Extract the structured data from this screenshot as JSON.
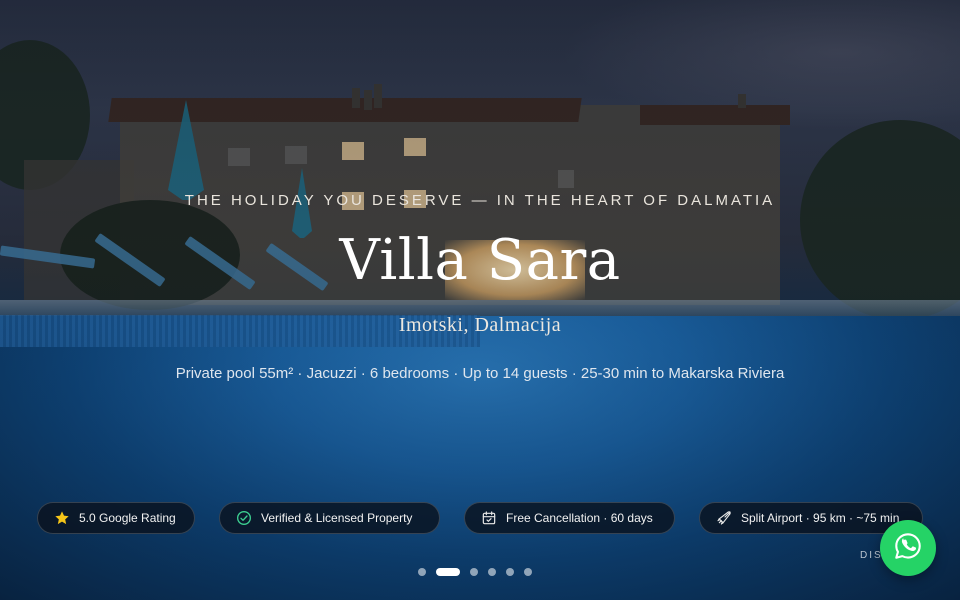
{
  "hero": {
    "eyebrow": "THE HOLIDAY YOU DESERVE — IN THE HEART OF DALMATIA",
    "title": "Villa Sara",
    "location": "Imotski, Dalmacija",
    "description": "Private pool 55m² · Jacuzzi · 6 bedrooms · Up to 14 guests · 25-30 min to Makarska Riviera"
  },
  "badges": [
    {
      "icon": "star-icon",
      "label": "5.0 Google Rating"
    },
    {
      "icon": "check-circle-icon",
      "label": "Verified & Licensed Property"
    },
    {
      "icon": "calendar-check-icon",
      "label": "Free Cancellation · 60 days"
    },
    {
      "icon": "plane-icon",
      "label": "Split Airport · 95 km · ~75 min"
    }
  ],
  "carousel": {
    "count": 6,
    "active_index": 1
  },
  "scroll_hint": "DISCOVER",
  "whatsapp": {
    "icon": "whatsapp-icon"
  },
  "colors": {
    "star": "#f5c518",
    "check": "#3ccf91",
    "whatsapp": "#25d366",
    "badge_bg": "#0a121e"
  }
}
